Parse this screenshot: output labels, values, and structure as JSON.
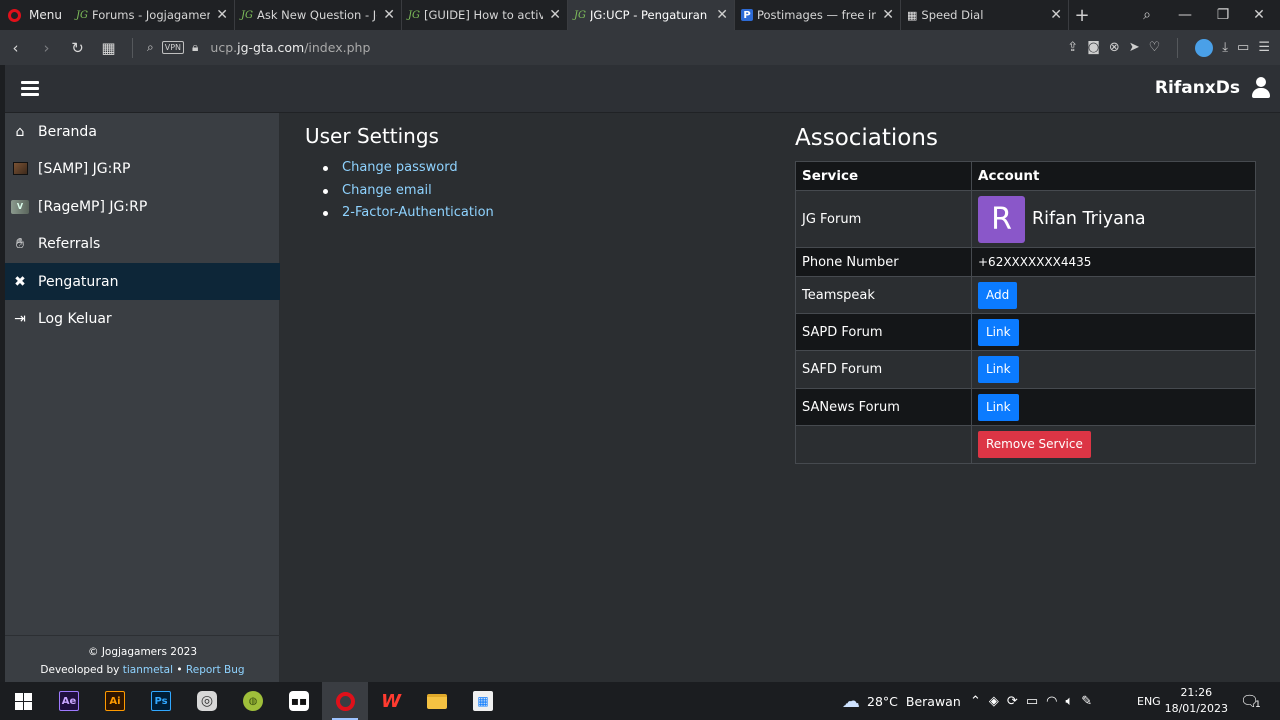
{
  "browser": {
    "menu_label": "Menu",
    "tabs": [
      {
        "title": "Forums - Jogjagamers",
        "icon": "jg-icon"
      },
      {
        "title": "Ask New Question - Jog",
        "icon": "jg-icon"
      },
      {
        "title": "[GUIDE] How to activate",
        "icon": "jg-icon"
      },
      {
        "title": "JG:UCP - Pengaturan",
        "icon": "jg-icon",
        "active": true
      },
      {
        "title": "Postimages — free ima",
        "icon": "postimages-icon"
      },
      {
        "title": "Speed Dial",
        "icon": "speed-dial-icon"
      }
    ],
    "url_prefix": "ucp.",
    "url_domain": "jg-gta.com",
    "url_path": "/index.php",
    "vpn_label": "VPN"
  },
  "header": {
    "username": "RifanxDs"
  },
  "sidebar": {
    "items": [
      {
        "label": "Beranda",
        "icon": "home-icon"
      },
      {
        "label": "[SAMP] JG:RP",
        "icon": "samp-icon"
      },
      {
        "label": "[RageMP] JG:RP",
        "icon": "ragemp-icon"
      },
      {
        "label": "Referrals",
        "icon": "handshake-icon"
      },
      {
        "label": "Pengaturan",
        "icon": "tools-icon",
        "active": true
      },
      {
        "label": "Log Keluar",
        "icon": "logout-icon"
      }
    ],
    "footer": {
      "copyright": "© Jogjagamers 2023",
      "developed_prefix": "Deveoloped by ",
      "developer": "tianmetal",
      "bullet": " • ",
      "report_bug": "Report Bug"
    }
  },
  "user_settings": {
    "title": "User Settings",
    "links": [
      "Change password",
      "Change email",
      "2-Factor-Authentication"
    ]
  },
  "associations": {
    "title": "Associations",
    "headers": {
      "service": "Service",
      "account": "Account"
    },
    "forum": {
      "service": "JG Forum",
      "avatar_letter": "R",
      "name": "Rifan Triyana",
      "avatar_color": "#8a57c9"
    },
    "phone": {
      "service": "Phone Number",
      "value": "+62XXXXXXX4435"
    },
    "rows": [
      {
        "service": "Teamspeak",
        "action": "Add"
      },
      {
        "service": "SAPD Forum",
        "action": "Link"
      },
      {
        "service": "SAFD Forum",
        "action": "Link"
      },
      {
        "service": "SANews Forum",
        "action": "Link"
      }
    ],
    "remove_label": "Remove Service"
  },
  "colors": {
    "accent_blue": "#0b7bff",
    "danger_red": "#dc3545",
    "link_color": "#8fd3ff",
    "sidebar_active": "#0d2638"
  },
  "taskbar": {
    "weather_temp": "28°C",
    "weather_desc": "Berawan",
    "language": "ENG",
    "time": "21:26",
    "date": "18/01/2023",
    "notifications": "1"
  }
}
